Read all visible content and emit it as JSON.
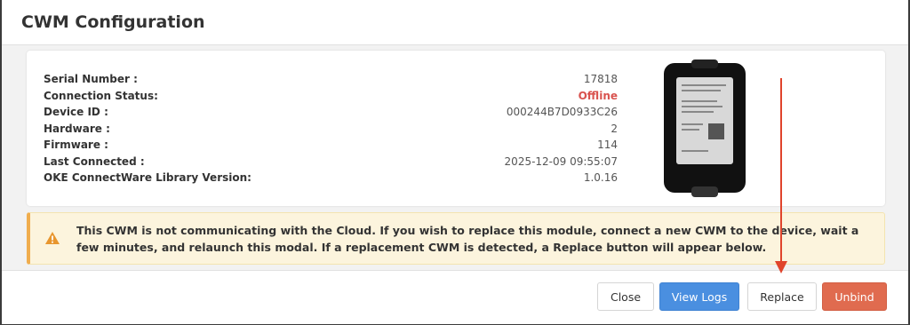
{
  "modal": {
    "title": "CWM Configuration"
  },
  "device_info": {
    "rows": [
      {
        "label": "Serial Number :",
        "value": "17818"
      },
      {
        "label": "Connection Status:",
        "value": "Offline"
      },
      {
        "label": "Device ID :",
        "value": "000244B7D0933C26"
      },
      {
        "label": "Hardware :",
        "value": "2"
      },
      {
        "label": "Firmware :",
        "value": "114"
      },
      {
        "label": "Last Connected :",
        "value": "2025-12-09 09:55:07"
      },
      {
        "label": "OKE ConnectWare Library Version:",
        "value": "1.0.16"
      }
    ]
  },
  "warning": {
    "icon": "warning-icon",
    "text": "This CWM is not communicating with the Cloud. If you wish to replace this module, connect a new CWM to the device, wait a few minutes, and relaunch this modal. If a replacement CWM is detected, a Replace button will appear below."
  },
  "footer": {
    "close_label": "Close",
    "view_logs_label": "View Logs",
    "replace_label": "Replace",
    "unbind_label": "Unbind"
  },
  "colors": {
    "offline": "#d9534f",
    "primary": "#4a8fe0",
    "danger": "#e06b4f",
    "warning_bg": "#fcf4dd",
    "annotation": "#e0442c"
  }
}
